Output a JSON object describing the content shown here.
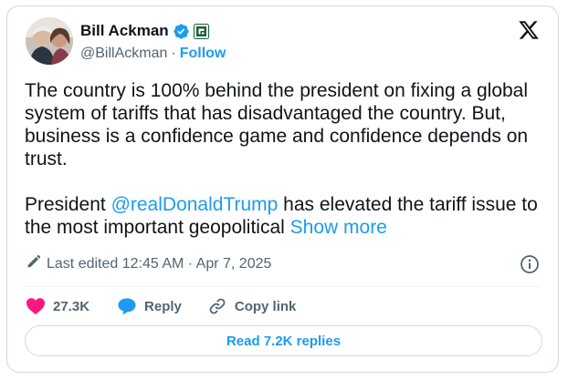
{
  "author": {
    "name": "Bill Ackman",
    "handle": "@BillAckman",
    "separator": "·",
    "follow_label": "Follow"
  },
  "tweet": {
    "paragraph_1": "The country is 100% behind the president on fixing a global system of tariffs that has disadvantaged the country. But, business is a confidence game and confidence depends on trust.",
    "paragraph_2_before": "President ",
    "mention": "@realDonaldTrump",
    "paragraph_2_after": " has elevated the tariff issue to the most important geopolitical ",
    "show_more": "Show more"
  },
  "meta": {
    "edited_text": "Last edited 12:45 AM · Apr 7, 2025"
  },
  "actions": {
    "likes_count": "27.3K",
    "reply_label": "Reply",
    "copy_link_label": "Copy link"
  },
  "replies_button_label": "Read 7.2K replies",
  "colors": {
    "accent": "#1d9bf0",
    "like": "#f91880",
    "text": "#0f1419",
    "secondary": "#536471",
    "border": "#cfd9de"
  },
  "icons": {
    "verified": "verified-badge-icon",
    "affiliate": "affiliate-badge-icon",
    "brand": "x-logo-icon",
    "edit": "pencil-icon",
    "info": "info-icon",
    "like": "heart-icon",
    "reply": "speech-bubble-icon",
    "copy_link": "link-icon"
  }
}
